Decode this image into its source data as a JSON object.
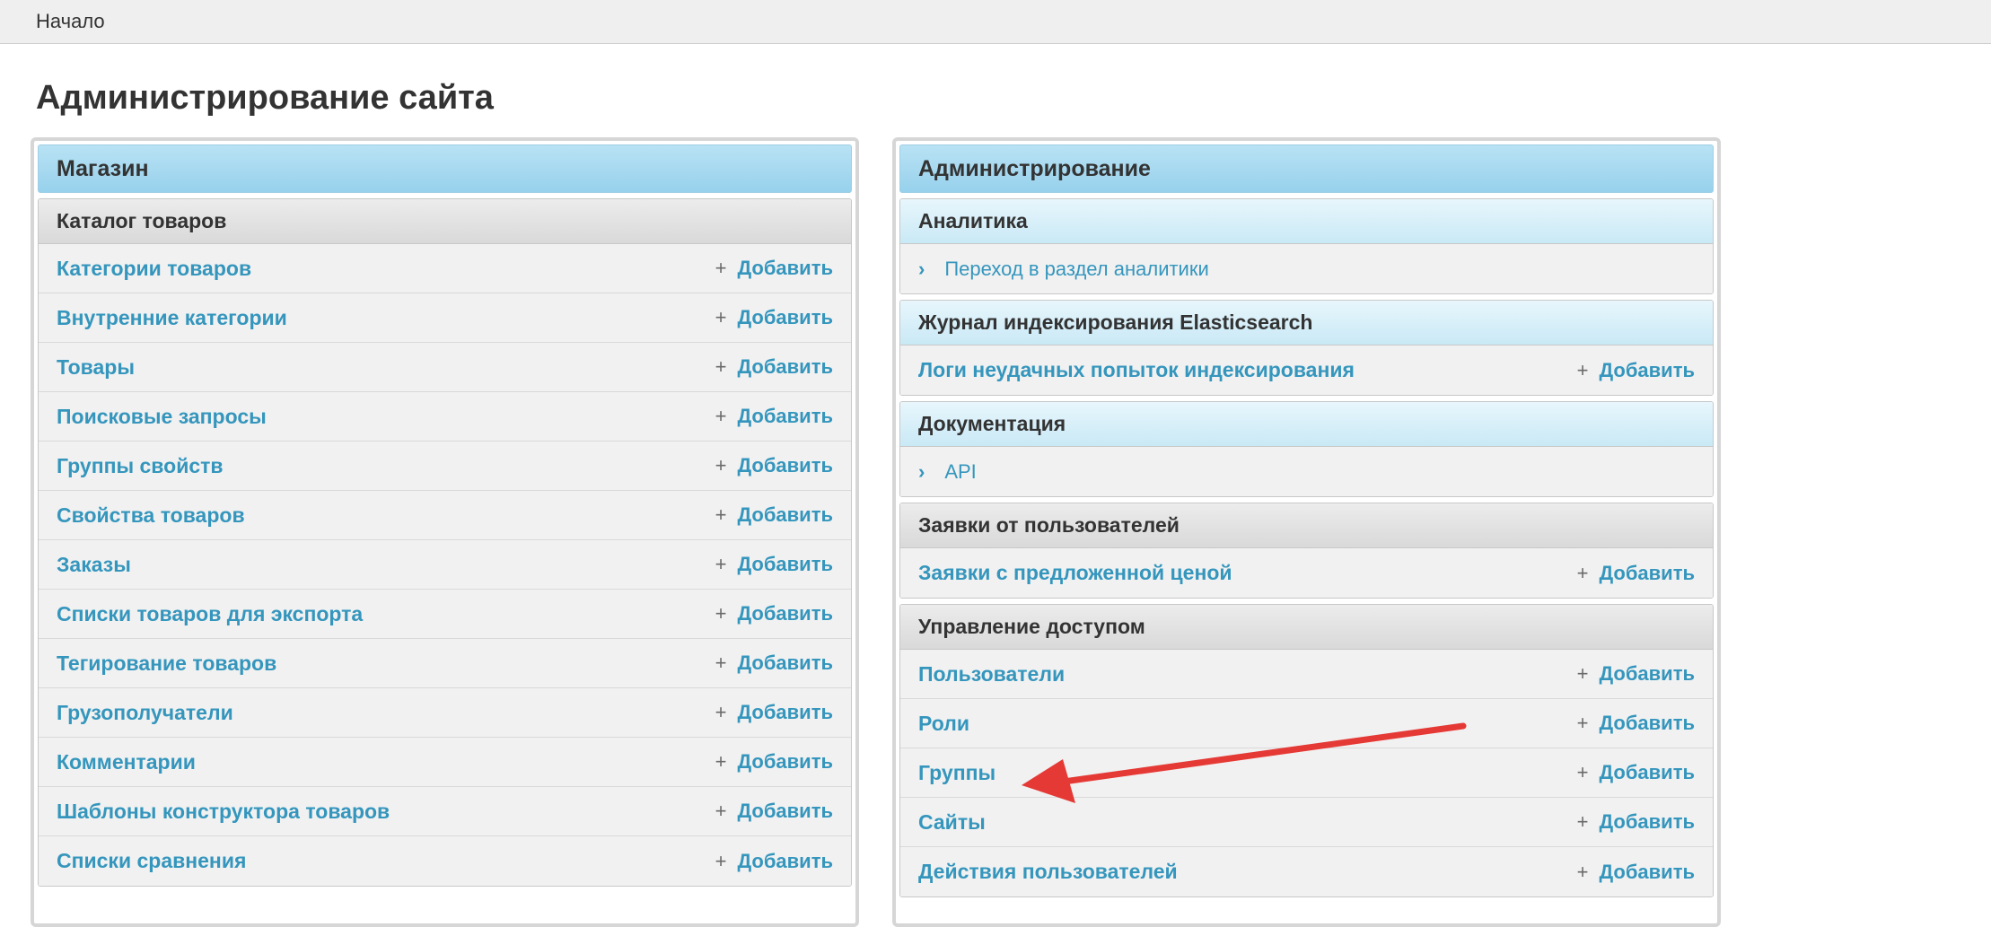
{
  "breadcrumb": {
    "home": "Начало"
  },
  "page_title": "Администрирование сайта",
  "add_label": "Добавить",
  "left_module": {
    "caption": "Магазин",
    "group_title": "Каталог товаров",
    "items": [
      "Категории товаров",
      "Внутренние категории",
      "Товары",
      "Поисковые запросы",
      "Группы свойств",
      "Свойства товаров",
      "Заказы",
      "Списки товаров для экспорта",
      "Тегирование товаров",
      "Грузополучатели",
      "Комментарии",
      "Шаблоны конструктора товаров",
      "Списки сравнения"
    ]
  },
  "right_module": {
    "caption": "Администрирование",
    "analytics": {
      "title": "Аналитика",
      "link": "Переход в раздел аналитики"
    },
    "elastic": {
      "title": "Журнал индексирования Elasticsearch",
      "item": "Логи неудачных попыток индексирования"
    },
    "docs": {
      "title": "Документация",
      "link": "API"
    },
    "requests": {
      "title": "Заявки от пользователей",
      "item": "Заявки с предложенной ценой"
    },
    "access": {
      "title": "Управление доступом",
      "items": [
        "Пользователи",
        "Роли",
        "Группы",
        "Сайты",
        "Действия пользователей"
      ]
    }
  },
  "colors": {
    "link": "#3596bd",
    "caption": "#a8daf0",
    "arrow": "#e53935"
  },
  "icons": {
    "add": "plus-icon",
    "link": "chevron-right-icon",
    "annotation": "arrow-icon"
  }
}
